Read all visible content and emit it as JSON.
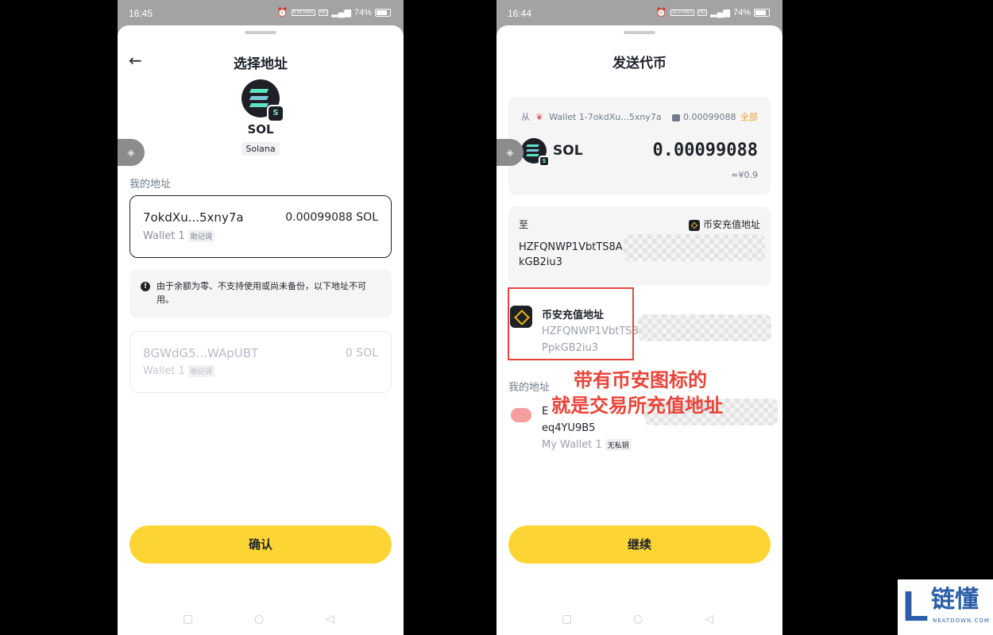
{
  "left": {
    "status": {
      "time": "16:45",
      "net_speed": "9.93 KB/s",
      "battery": "74%"
    },
    "title": "选择地址",
    "coin": {
      "symbol": "SOL",
      "network": "Solana",
      "badge_glyph": "S"
    },
    "my_address_label": "我的地址",
    "selected_address": {
      "address": "7okdXu...5xny7a",
      "balance": "0.00099088 SOL",
      "wallet": "Wallet 1",
      "tag": "助记词"
    },
    "notice": "由于余额为零、不支持使用或尚未备份，以下地址不可用。",
    "disabled_address": {
      "address": "8GWdG5...WApUBT",
      "balance": "0 SOL",
      "wallet": "Wallet 1",
      "tag": "助记词"
    },
    "confirm_label": "确认"
  },
  "right": {
    "status": {
      "time": "16:44",
      "net_speed": "15.4 KB/s",
      "battery": "74%"
    },
    "title": "发送代币",
    "from": {
      "label": "从",
      "wallet": "Wallet 1-7okdXu...5xny7a",
      "balance": "0.00099088",
      "all_label": "全部"
    },
    "coin": {
      "symbol": "SOL",
      "amount": "0.00099088",
      "fiat": "≈¥0.9"
    },
    "to": {
      "label": "至",
      "source": "币安充值地址",
      "address_line1": "HZFQNWP1VbtTS8A",
      "address_line2": "kGB2iu3"
    },
    "binance_entry": {
      "name": "币安充值地址",
      "address_line1": "HZFQNWP1VbtTS8",
      "address_line2": "PpkGB2iu3"
    },
    "my_address_label": "我的地址",
    "my_entry": {
      "address_line1": "E",
      "address_line2": "eq4YU9B5",
      "wallet": "My Wallet 1",
      "tag": "无私钥"
    },
    "continue_label": "继续"
  },
  "annotation": {
    "line1": "带有币安图标的",
    "line2": "就是交易所充值地址"
  },
  "watermark": {
    "brand": "链懂",
    "domain": "NEATDOWN.COM",
    "letter": "L"
  },
  "colors": {
    "accent_yellow": "#fcd535",
    "binance_gold": "#f0b90b",
    "annotation_red": "#e8443a",
    "text_dark": "#1e2329",
    "text_gray": "#707a8a"
  },
  "icons": {
    "back": "arrow-left-icon",
    "home": "square-icon",
    "nav_home": "circle-icon",
    "nav_back": "triangle-icon"
  }
}
